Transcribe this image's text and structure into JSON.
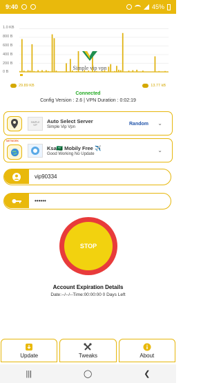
{
  "status_bar": {
    "time": "9:40",
    "battery": "45%"
  },
  "chart": {
    "y_ticks": [
      "1.0 KB",
      "800 B",
      "600 B",
      "400 B",
      "200 B",
      "0 B"
    ]
  },
  "chart_data": {
    "type": "bar",
    "title": "",
    "xlabel": "",
    "ylabel": "",
    "ylim": [
      0,
      1024
    ],
    "values": [
      20,
      760,
      30,
      10,
      40,
      30,
      640,
      20,
      10,
      40,
      10,
      40,
      10,
      40,
      20,
      10,
      870,
      780,
      30,
      10,
      10,
      10,
      10,
      200,
      10,
      300,
      30,
      10,
      20,
      480,
      10,
      10,
      40,
      10,
      30,
      10,
      410,
      20,
      20,
      10,
      10,
      20,
      40,
      10,
      120,
      180,
      10,
      20,
      140,
      50,
      40,
      900,
      10,
      10,
      30,
      10,
      40,
      10,
      50,
      10,
      10,
      30,
      10,
      10,
      10,
      10,
      10,
      360,
      10,
      20,
      10,
      10,
      20,
      10
    ]
  },
  "logo": {
    "text": "Simple vip vpn"
  },
  "stats": {
    "download": "29.89 KB",
    "upload": "13.77 kB"
  },
  "connection": {
    "status": "Connected",
    "config_line": "Config Version : 2.6  |  VPN Duration : 0:02:19"
  },
  "server_card": {
    "title": "Auto Select Server",
    "subtitle": "Simple Vip Vpn",
    "action": "Random"
  },
  "network_card": {
    "tag": "NETWORK",
    "title": "Ksa🇸🇦 Mobily Free ✈️",
    "subtitle": "Good Working No Update"
  },
  "username": {
    "value": "vip90334"
  },
  "password": {
    "value": "••••••"
  },
  "stop_button": {
    "label": "STOP"
  },
  "expiration": {
    "title": "Account Expiration Details",
    "line": "Date:--/--/--Time:00:00:00 0 Days Left"
  },
  "tabs": [
    {
      "label": "Update",
      "icon": "update-icon"
    },
    {
      "label": "Tweaks",
      "icon": "tools-icon"
    },
    {
      "label": "About",
      "icon": "info-icon"
    }
  ],
  "colors": {
    "accent": "#e9b90c",
    "stop_ring": "#e83b3b",
    "connected": "#22aa22"
  }
}
